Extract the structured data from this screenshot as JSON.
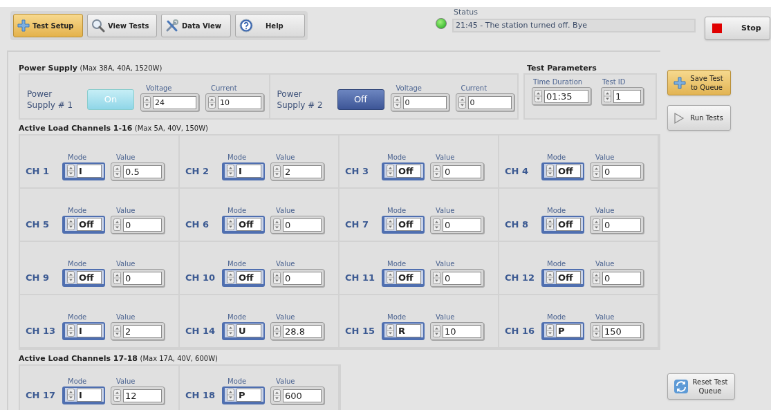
{
  "toolbar": {
    "tabs": [
      {
        "label": "Test Setup",
        "selected": true,
        "kind": "plus"
      },
      {
        "label": "View Tests",
        "selected": false,
        "kind": "search"
      },
      {
        "label": "Data View",
        "selected": false,
        "kind": "tools"
      },
      {
        "label": "Help",
        "selected": false,
        "kind": "help"
      }
    ]
  },
  "status": {
    "label": "Status",
    "indicator_on": true,
    "text": "21:45 - The station turned off. Bye"
  },
  "stop_button": {
    "label": "Stop"
  },
  "power_supply": {
    "title": "Power Supply",
    "note": "(Max 38A, 40A, 1520W)",
    "supplies": [
      {
        "name": "Power Supply # 1",
        "on": true,
        "switch_label": "On",
        "voltage_label": "Voltage",
        "voltage": "24",
        "current_label": "Current",
        "current": "10"
      },
      {
        "name": "Power Supply # 2",
        "on": false,
        "switch_label": "Off",
        "voltage_label": "Voltage",
        "voltage": "0",
        "current_label": "Current",
        "current": "0"
      }
    ]
  },
  "test_parameters": {
    "title": "Test Parameters",
    "fields": [
      {
        "label": "Time Duration",
        "value": "01:35"
      },
      {
        "label": "Test ID",
        "value": "1"
      }
    ]
  },
  "side_buttons": [
    {
      "label": "Save Test to Queue",
      "kind": "plus"
    },
    {
      "label": "Run Tests",
      "kind": "play"
    }
  ],
  "channel_groups": [
    {
      "title": "Active Load Channels 1-16",
      "note": "(Max 5A, 40V, 150W)",
      "channels": [
        {
          "name": "CH 1",
          "mode_label": "Mode",
          "mode": "I",
          "value_label": "Value",
          "value": "0.5"
        },
        {
          "name": "CH 2",
          "mode_label": "Mode",
          "mode": "I",
          "value_label": "Value",
          "value": "2"
        },
        {
          "name": "CH 3",
          "mode_label": "Mode",
          "mode": "Off",
          "value_label": "Value",
          "value": "0"
        },
        {
          "name": "CH 4",
          "mode_label": "Mode",
          "mode": "Off",
          "value_label": "Value",
          "value": "0"
        },
        {
          "name": "CH 5",
          "mode_label": "Mode",
          "mode": "Off",
          "value_label": "Value",
          "value": "0"
        },
        {
          "name": "CH 6",
          "mode_label": "Mode",
          "mode": "Off",
          "value_label": "Value",
          "value": "0"
        },
        {
          "name": "CH 7",
          "mode_label": "Mode",
          "mode": "Off",
          "value_label": "Value",
          "value": "0"
        },
        {
          "name": "CH 8",
          "mode_label": "Mode",
          "mode": "Off",
          "value_label": "Value",
          "value": "0"
        },
        {
          "name": "CH 9",
          "mode_label": "Mode",
          "mode": "Off",
          "value_label": "Value",
          "value": "0"
        },
        {
          "name": "CH 10",
          "mode_label": "Mode",
          "mode": "Off",
          "value_label": "Value",
          "value": "0"
        },
        {
          "name": "CH 11",
          "mode_label": "Mode",
          "mode": "Off",
          "value_label": "Value",
          "value": "0"
        },
        {
          "name": "CH 12",
          "mode_label": "Mode",
          "mode": "Off",
          "value_label": "Value",
          "value": "0"
        },
        {
          "name": "CH 13",
          "mode_label": "Mode",
          "mode": "I",
          "value_label": "Value",
          "value": "2"
        },
        {
          "name": "CH 14",
          "mode_label": "Mode",
          "mode": "U",
          "value_label": "Value",
          "value": "28.8"
        },
        {
          "name": "CH 15",
          "mode_label": "Mode",
          "mode": "R",
          "value_label": "Value",
          "value": "10"
        },
        {
          "name": "CH 16",
          "mode_label": "Mode",
          "mode": "P",
          "value_label": "Value",
          "value": "150"
        }
      ]
    },
    {
      "title": "Active Load Channels 17-18",
      "note": "(Max 17A, 40V, 600W)",
      "channels": [
        {
          "name": "CH 17",
          "mode_label": "Mode",
          "mode": "I",
          "value_label": "Value",
          "value": "12"
        },
        {
          "name": "CH 18",
          "mode_label": "Mode",
          "mode": "P",
          "value_label": "Value",
          "value": "600"
        }
      ]
    }
  ],
  "reset_button": {
    "label": "Reset Test Queue",
    "kind": "refresh"
  }
}
